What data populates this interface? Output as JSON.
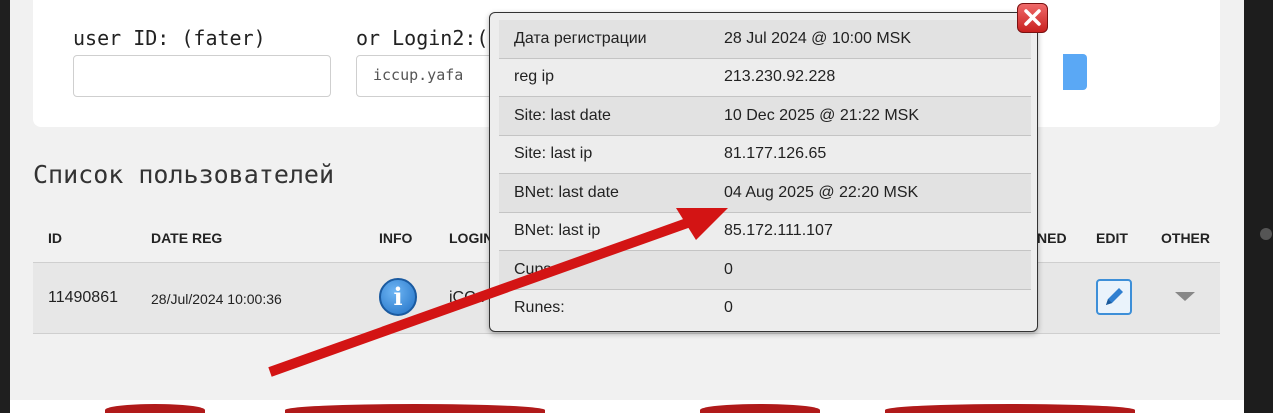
{
  "search": {
    "user_id_label": "user ID: (fater)",
    "login_label": "or Login2:(",
    "user_id_value": "",
    "login_value": "iccup.yafa"
  },
  "list": {
    "title": "Список пользователей",
    "columns": {
      "id": "ID",
      "date_reg": "DATE REG",
      "info": "INFO",
      "login": "LOGIN",
      "banned": "NED",
      "edit": "EDIT",
      "other": "OTHER"
    },
    "rows": [
      {
        "id": "11490861",
        "date_reg": "28/Jul/2024 10:00:36",
        "login": "iCCu"
      }
    ]
  },
  "popup": {
    "rows": [
      {
        "key": "Дата регистрации",
        "value": "28 Jul 2024 @ 10:00 MSK"
      },
      {
        "key": "reg ip",
        "value": "213.230.92.228"
      },
      {
        "key": "Site: last date",
        "value": "10 Dec 2025 @ 21:22 MSK"
      },
      {
        "key": "Site: last ip",
        "value": "81.177.126.65"
      },
      {
        "key": "BNet: last date",
        "value": "04 Aug 2025 @ 22:20 MSK"
      },
      {
        "key": "BNet: last ip",
        "value": "85.172.111.107"
      },
      {
        "key": "Cups",
        "value": "0"
      },
      {
        "key": "Runes:",
        "value": "0"
      }
    ]
  },
  "icons": {
    "info": "info-icon",
    "edit": "pencil-icon",
    "other": "chevron-down-icon",
    "close": "close-icon"
  },
  "colors": {
    "accent": "#5aa8f5",
    "annotation_arrow": "#d31414",
    "close_button": "#d93030"
  }
}
